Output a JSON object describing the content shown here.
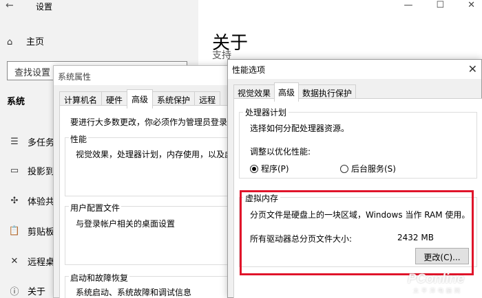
{
  "settings": {
    "back_icon": "←",
    "title": "设置",
    "window_controls": [
      "—",
      "☐",
      "✕"
    ],
    "home": {
      "icon": "⌂",
      "label": "主页"
    },
    "search_placeholder": "查找设置",
    "section": "系统",
    "nav_items": [
      {
        "icon": "☰",
        "label": "多任务"
      },
      {
        "icon": "▭",
        "label": "投影到"
      },
      {
        "icon": "✣",
        "label": "体验共"
      },
      {
        "icon": "📋",
        "label": "剪贴板"
      },
      {
        "icon": "✕",
        "label": "远程桌"
      },
      {
        "icon": "ⓘ",
        "label": "关于"
      }
    ],
    "page_title": "关于",
    "page_subtitle": "支持"
  },
  "system_properties": {
    "title": "系统属性",
    "tabs": [
      "计算机名",
      "硬件",
      "高级",
      "系统保护",
      "远程"
    ],
    "active_tab": "高级",
    "admin_note": "要进行大多数更改，你必须作为管理员登录。",
    "groups": {
      "performance": {
        "label": "性能",
        "text": "视觉效果，处理器计划，内存使用，以及虚拟内"
      },
      "user_profiles": {
        "label": "用户配置文件",
        "text": "与登录帐户相关的桌面设置"
      },
      "startup": {
        "label": "启动和故障恢复",
        "text": "系统启动、系统故障和调试信息"
      }
    }
  },
  "performance_options": {
    "title": "性能选项",
    "close_icon": "✕",
    "tabs": [
      "视觉效果",
      "高级",
      "数据执行保护"
    ],
    "active_tab": "高级",
    "processor": {
      "label": "处理器计划",
      "description": "选择如何分配处理器资源。",
      "optimize_label": "调整以优化性能:",
      "options": [
        {
          "label": "程序(P)",
          "selected": true
        },
        {
          "label": "后台服务(S)",
          "selected": false
        }
      ]
    },
    "virtual_memory": {
      "label": "虚拟内存",
      "description": "分页文件是硬盘上的一块区域，Windows 当作 RAM 使用。",
      "total_label": "所有驱动器总分页文件大小:",
      "total_value": "2432 MB",
      "change_button": "更改(C)..."
    }
  },
  "watermark": {
    "main": "PConline",
    "sub": "太平洋电脑网"
  },
  "colors": {
    "highlight": "#e0142a",
    "settings_nav_bg": "#f2f2f2",
    "dialog_bg": "#f0f0f0"
  }
}
